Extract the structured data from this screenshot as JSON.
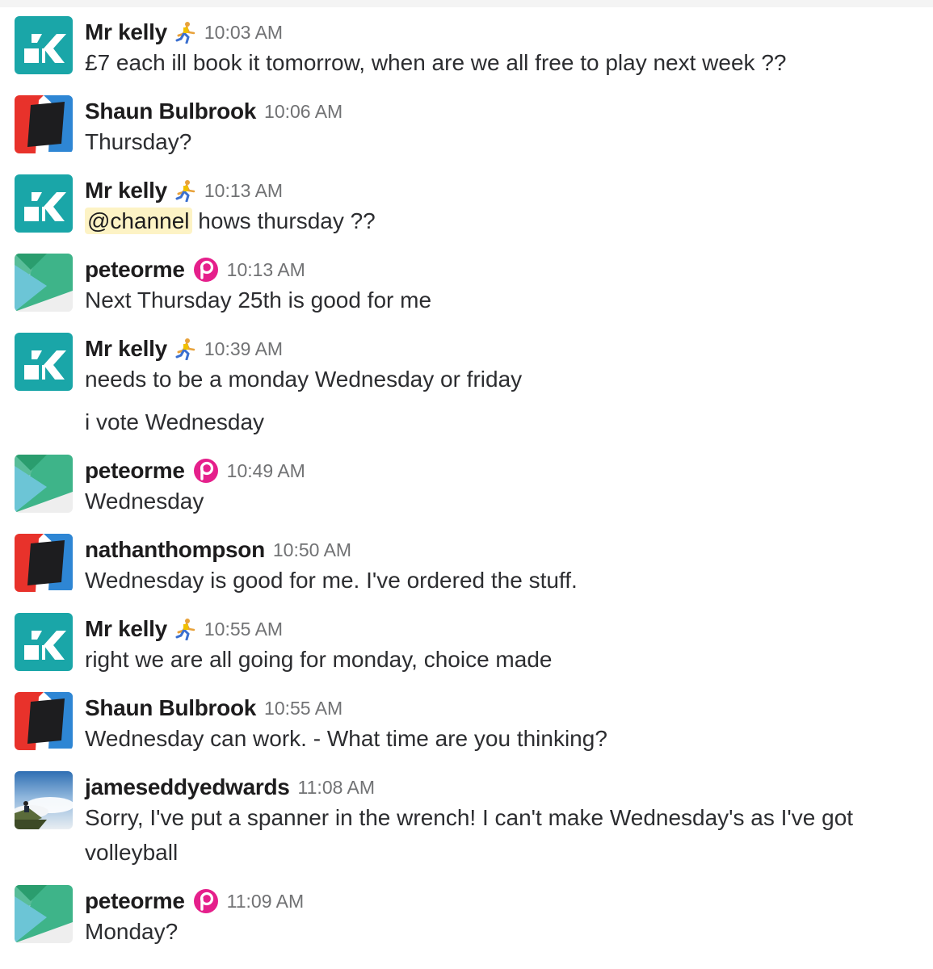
{
  "colors": {
    "ck_teal": "#1aa6a8",
    "red": "#e8322b",
    "blue": "#2e86d4",
    "dark": "#1d1d1f",
    "green": "#3eb489",
    "light_blue": "#6cc5d6",
    "pink": "#e51f8b",
    "mention_bg": "#fdf3c5",
    "timestamp": "#717274"
  },
  "messages": [
    {
      "author": "Mr kelly",
      "avatar": "ck-logo-avatar",
      "badge": "runner-emoji-icon",
      "time": "10:03 AM",
      "lines": [
        "£7 each ill book it tomorrow, when are we all free to play next week ??"
      ]
    },
    {
      "author": "Shaun Bulbrook",
      "avatar": "red-blue-black-square-avatar",
      "badge": "",
      "time": "10:06 AM",
      "lines": [
        "Thursday?"
      ]
    },
    {
      "author": "Mr kelly",
      "avatar": "ck-logo-avatar",
      "badge": "runner-emoji-icon",
      "time": "10:13 AM",
      "mention": "@channel",
      "lines": [
        "hows thursday ??"
      ]
    },
    {
      "author": "peteorme",
      "avatar": "green-triangle-avatar",
      "badge": "pink-p-logo-icon",
      "time": "10:13 AM",
      "lines": [
        "Next Thursday 25th is good for me"
      ]
    },
    {
      "author": "Mr kelly",
      "avatar": "ck-logo-avatar",
      "badge": "runner-emoji-icon",
      "time": "10:39 AM",
      "lines": [
        "needs to be a monday Wednesday or friday",
        "i vote Wednesday"
      ]
    },
    {
      "author": "peteorme",
      "avatar": "green-triangle-avatar",
      "badge": "pink-p-logo-icon",
      "time": "10:49 AM",
      "lines": [
        "Wednesday"
      ]
    },
    {
      "author": "nathanthompson",
      "avatar": "red-blue-black-square-avatar",
      "badge": "",
      "time": "10:50 AM",
      "lines": [
        "Wednesday is good for me. I've ordered the stuff."
      ]
    },
    {
      "author": "Mr kelly",
      "avatar": "ck-logo-avatar",
      "badge": "runner-emoji-icon",
      "time": "10:55 AM",
      "lines": [
        "right we are all going for monday, choice made"
      ]
    },
    {
      "author": "Shaun Bulbrook",
      "avatar": "red-blue-black-square-avatar",
      "badge": "",
      "time": "10:55 AM",
      "lines": [
        "Wednesday can work. - What time are you thinking?"
      ]
    },
    {
      "author": "jameseddyedwards",
      "avatar": "mountain-photo-avatar",
      "badge": "",
      "time": "11:08 AM",
      "lines": [
        "Sorry, I've put a spanner in the wrench! I can't make Wednesday's as I've got",
        "volleyball"
      ]
    },
    {
      "author": "peteorme",
      "avatar": "green-triangle-avatar",
      "badge": "pink-p-logo-icon",
      "time": "11:09 AM",
      "lines": [
        "Monday?"
      ]
    }
  ]
}
